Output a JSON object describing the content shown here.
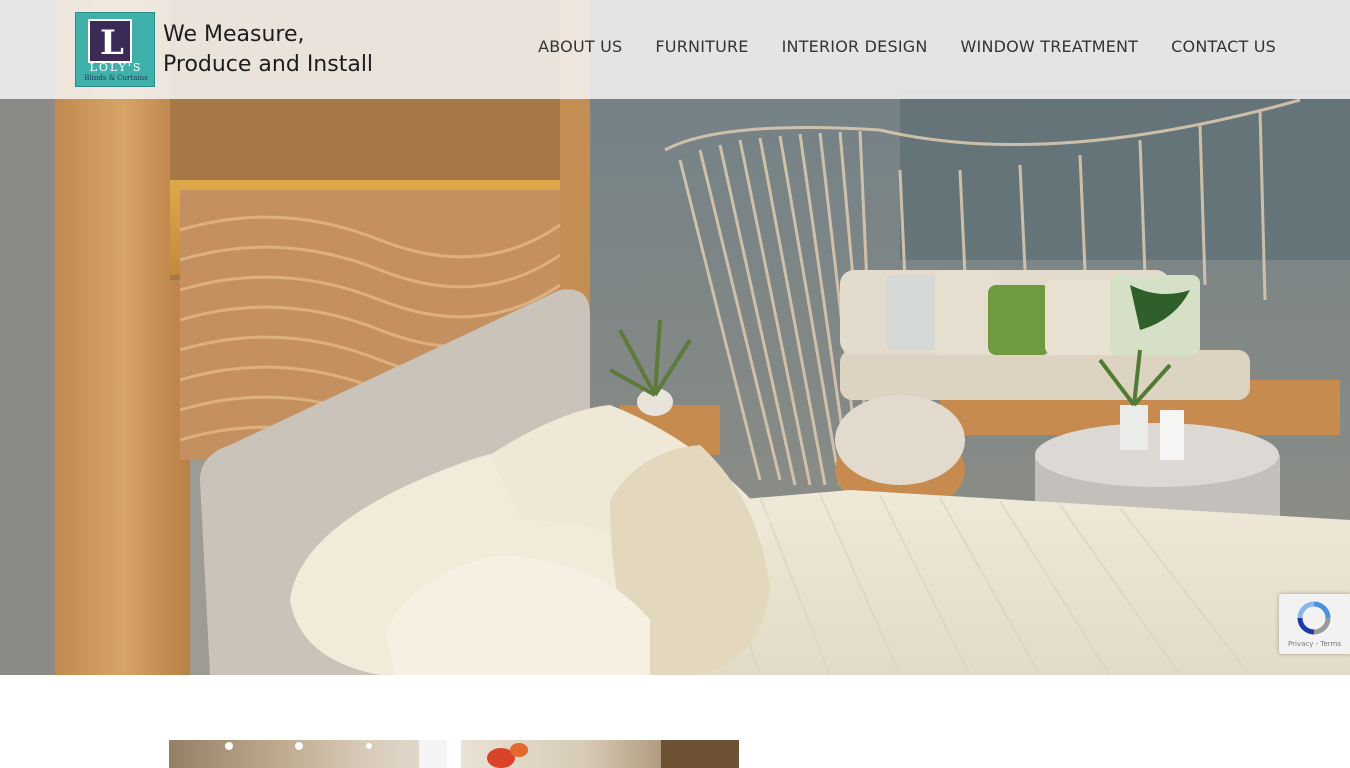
{
  "brand": {
    "logo_letter": "L",
    "logo_name": "LOLY'S",
    "logo_sub": "Blinds & Curtains",
    "tagline_line1": "We Measure,",
    "tagline_line2": "Produce and Install"
  },
  "nav": {
    "items": [
      {
        "label": "ABOUT US"
      },
      {
        "label": "FURNITURE"
      },
      {
        "label": "INTERIOR DESIGN"
      },
      {
        "label": "WINDOW TREATMENT"
      },
      {
        "label": "CONTACT US"
      }
    ]
  },
  "recaptcha": {
    "text": "Privacy - Terms"
  },
  "colors": {
    "logo_teal": "#3fb1aa",
    "logo_purple": "#3b2a56",
    "header_bg": "#f5f5f5",
    "nav_text": "#333333"
  }
}
